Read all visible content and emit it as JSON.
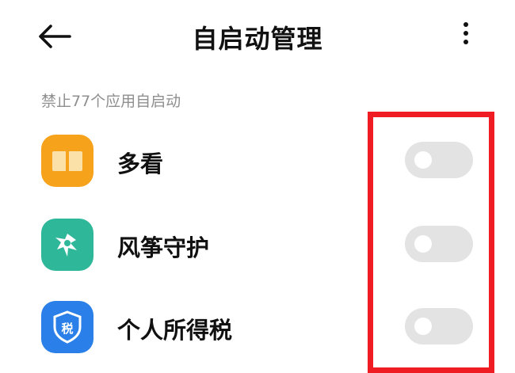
{
  "header": {
    "title": "自启动管理",
    "back_icon": "arrow-left-icon",
    "more_icon": "more-vertical-icon"
  },
  "section": {
    "label": "禁止77个应用自启动"
  },
  "apps": [
    {
      "name": "多看",
      "icon": "open-book-icon",
      "icon_color": "#f7a21b",
      "autostart": false
    },
    {
      "name": "风筝守护",
      "icon": "kite-icon",
      "icon_color": "#2fb79a",
      "autostart": false
    },
    {
      "name": "个人所得税",
      "icon": "tax-shield-icon",
      "icon_color": "#2a7fe8",
      "icon_text": "税",
      "autostart": false
    }
  ],
  "colors": {
    "highlight": "#ef1c24",
    "toggle_off": "#e3e3e3",
    "label_gray": "#8f8f8f"
  }
}
